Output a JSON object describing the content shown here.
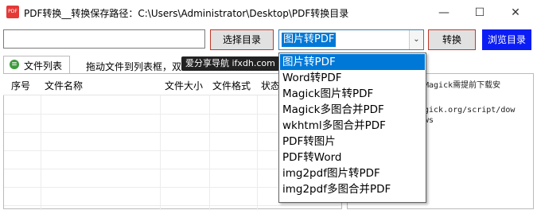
{
  "window": {
    "title": "PDF转换__转换保存路径：C:\\Users\\Administrator\\Desktop\\PDF转换目录",
    "app_icon_text": "PDF",
    "controls": [
      "—",
      "☐",
      "✕"
    ]
  },
  "toolbar": {
    "path_value": "",
    "select_dir_label": "选择目录",
    "mode_selected": "图片转PDF",
    "convert_label": "转换",
    "browse_label": "浏览目录",
    "dropdown_arrow": "⌄"
  },
  "tabs": {
    "file_list_label": "文件列表"
  },
  "hint": {
    "text": "拖动文件到列表框，双"
  },
  "watermark": {
    "text_cn": "爱分享导航",
    "text_en": "ifxdh.com"
  },
  "table": {
    "columns": [
      "序号",
      "文件名称",
      "文件大小",
      "文件格式",
      "状态"
    ]
  },
  "log": {
    "lines": [
      "Magick需提前下载安",
      "",
      "gick.org/script/dow",
      "ws"
    ]
  },
  "dropdown": {
    "options": [
      "图片转PDF",
      "Word转PDF",
      "Magick图片转PDF",
      "Magick多图合并PDF",
      "wkhtml多图合并PDF",
      "PDF转图片",
      "PDF转Word",
      "img2pdf图片转PDF",
      "img2pdf多图合并PDF"
    ],
    "selected_index": 0
  },
  "colors": {
    "accent": "#0078d7",
    "browse_button": "#0b1df5",
    "highlight_border": "#c0392b"
  }
}
